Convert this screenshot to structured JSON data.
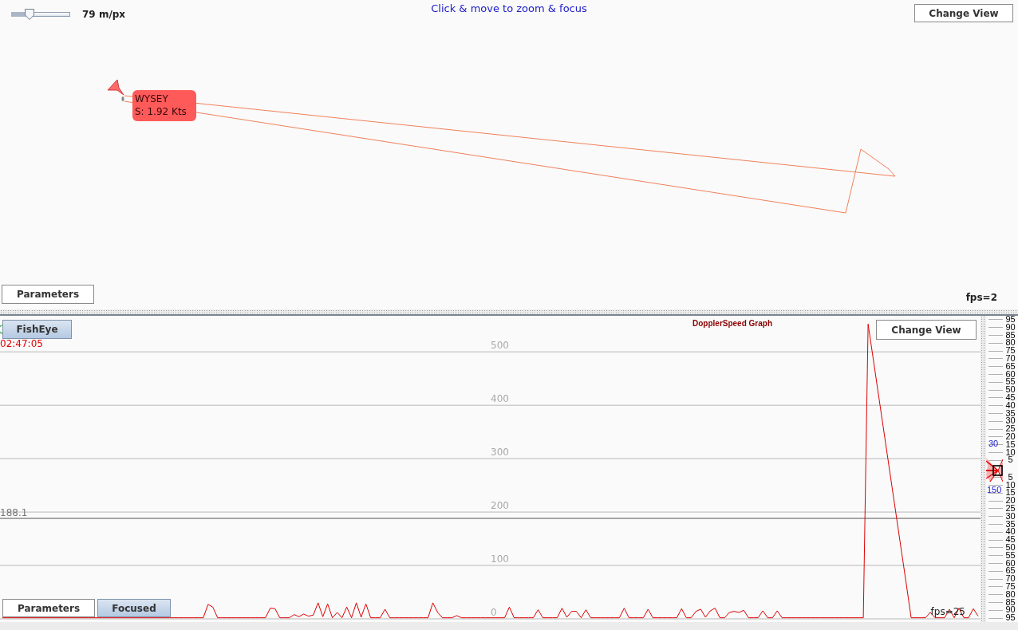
{
  "map_view": {
    "scale_slider": {
      "level": 0.31
    },
    "scale_reading": "79 m/px",
    "hint": "Click & move to zoom & focus",
    "change_view_button": "Change View",
    "vessel": {
      "name": "WYSEY",
      "speed": "S: 1.92 Kts"
    },
    "parameters_button": "Parameters",
    "fps": "fps=2"
  },
  "graph_view": {
    "fisheye_button": {
      "label": "FishEye",
      "selected": true
    },
    "time": "02:47:05",
    "change_view_button": "Change View",
    "chart_data": {
      "type": "line",
      "title": "DopplerSpeed Graph",
      "categories": [
        null,
        null,
        null,
        null,
        null,
        null,
        null,
        null,
        null,
        null,
        null,
        null,
        null,
        null,
        null,
        null,
        null,
        null,
        null,
        null,
        null,
        null,
        null,
        null,
        null,
        null,
        null,
        null,
        null,
        null,
        null,
        null,
        null,
        null,
        null,
        null,
        null,
        null,
        null,
        null,
        null,
        null,
        null,
        null,
        null,
        null,
        null,
        null,
        null,
        null,
        null,
        null,
        null,
        null,
        null,
        null,
        null,
        null,
        null,
        null,
        null,
        null,
        null,
        null,
        null,
        null,
        null,
        null,
        null,
        null,
        null,
        null,
        null,
        null,
        null,
        null,
        null,
        null,
        null,
        null,
        null,
        null,
        null,
        null,
        null,
        null,
        null,
        null,
        null,
        null,
        null,
        null,
        null,
        null,
        null,
        null,
        null,
        null,
        null,
        null,
        null,
        null,
        null,
        null,
        null,
        null,
        null,
        null,
        null,
        null,
        null,
        null,
        null,
        null,
        null,
        null,
        null,
        null,
        null,
        null,
        null,
        null,
        null,
        null,
        null,
        null,
        null,
        null,
        null,
        null,
        null,
        null,
        null,
        null,
        null,
        null,
        null,
        null,
        null,
        null,
        null,
        null,
        null,
        null,
        null,
        null,
        null,
        null,
        null,
        null,
        null,
        null,
        null,
        null,
        null,
        null,
        null,
        null,
        null,
        null,
        null,
        null,
        null,
        null,
        null,
        null,
        null,
        null,
        null,
        null,
        null,
        null,
        null,
        null,
        null,
        null,
        null,
        null,
        null,
        null,
        null,
        null,
        null,
        null,
        null,
        null,
        null,
        null,
        null,
        null,
        null,
        null,
        null,
        null,
        null,
        null,
        null,
        null,
        null,
        null,
        null,
        null,
        null,
        null,
        null
      ],
      "ylim": [
        0,
        569
      ],
      "yticks": [
        {
          "value": 0,
          "label": "0"
        },
        {
          "value": 100,
          "label": "100"
        },
        {
          "value": 200,
          "label": "200"
        },
        {
          "value": 300,
          "label": "300"
        },
        {
          "value": 400,
          "label": "400"
        },
        {
          "value": 500,
          "label": "500"
        }
      ],
      "grid": true,
      "series": [
        {
          "color": "#dd0000",
          "values": [
            2,
            2,
            2,
            2,
            2,
            2,
            2,
            2,
            2,
            2,
            2,
            2,
            2,
            2,
            2,
            2,
            2,
            2,
            2,
            2,
            2,
            2,
            2,
            2,
            2,
            2,
            2,
            2,
            2,
            2,
            2,
            2,
            2,
            2,
            2,
            2,
            2,
            2,
            2,
            2,
            2,
            2,
            2,
            27,
            22,
            2,
            2,
            2,
            2,
            2,
            2,
            2,
            2,
            2,
            2,
            2,
            20,
            19,
            2,
            2,
            2,
            8,
            4,
            9,
            5,
            7,
            30,
            4,
            28,
            2,
            12,
            2,
            22,
            2,
            30,
            3,
            28,
            2,
            2,
            2,
            18,
            2,
            2,
            2,
            2,
            2,
            2,
            2,
            2,
            2,
            30,
            12,
            2,
            2,
            2,
            6,
            2,
            2,
            2,
            2,
            2,
            2,
            2,
            2,
            2,
            2,
            22,
            2,
            2,
            2,
            2,
            2,
            17,
            2,
            2,
            2,
            2,
            20,
            3,
            14,
            14,
            2,
            17,
            2,
            2,
            2,
            2,
            2,
            2,
            2,
            20,
            2,
            2,
            2,
            2,
            18,
            2,
            2,
            2,
            2,
            2,
            2,
            19,
            2,
            2,
            14,
            18,
            3,
            15,
            20,
            2,
            2,
            12,
            14,
            12,
            16,
            2,
            2,
            2,
            15,
            2,
            2,
            15,
            2,
            2,
            2,
            2,
            2,
            2,
            2,
            2,
            2,
            2,
            2,
            2,
            2,
            2,
            2,
            2,
            2,
            2,
            552,
            491,
            430,
            369,
            308,
            247,
            186,
            125,
            64,
            2,
            2,
            2,
            2,
            12,
            2,
            2,
            2,
            18,
            2,
            20,
            2,
            2,
            19,
            5
          ]
        }
      ],
      "ref_lines": [
        {
          "axis": "y",
          "value": 188.1,
          "label": "188.1"
        }
      ]
    },
    "footer_buttons": [
      {
        "label": "Parameters",
        "selected": false
      },
      {
        "label": "Focused",
        "selected": true
      }
    ],
    "fps": "fps=25"
  },
  "range_scale": {
    "upper_labels": [
      "95",
      "90",
      "85",
      "80",
      "75",
      "70",
      "65",
      "60",
      "55",
      "50",
      "45",
      "40",
      "35",
      "30",
      "25",
      "20",
      "15",
      "10",
      "5"
    ],
    "polar_labels": [
      "30",
      "150"
    ],
    "lower_labels": [
      "5",
      "10",
      "15",
      "20",
      "25",
      "30",
      "35",
      "40",
      "45",
      "50",
      "55",
      "60",
      "65",
      "70",
      "75",
      "80",
      "85",
      "90",
      "95"
    ]
  }
}
